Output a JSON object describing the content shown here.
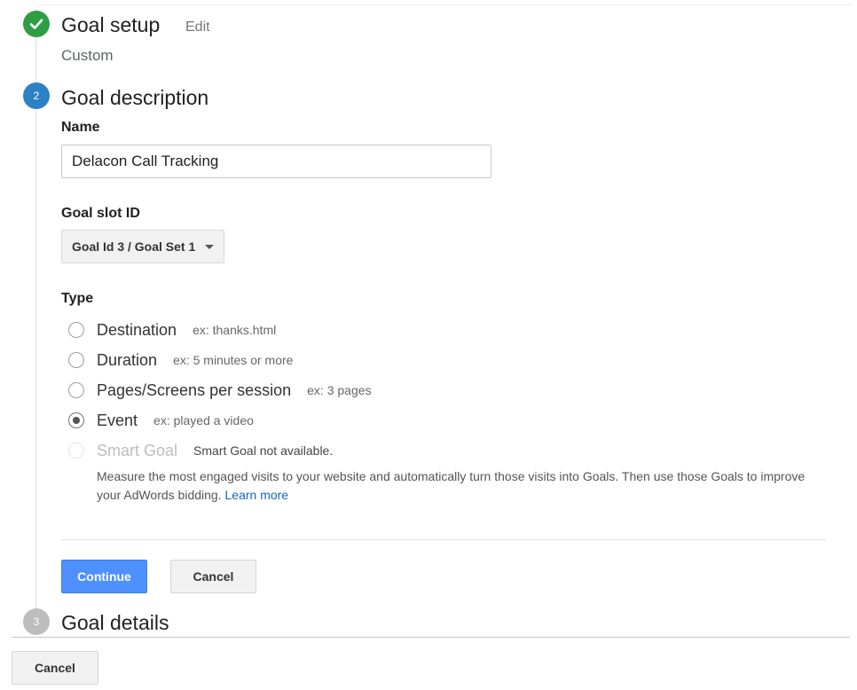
{
  "steps": {
    "setup": {
      "title": "Goal setup",
      "edit_label": "Edit",
      "value": "Custom"
    },
    "description": {
      "number": "2",
      "title": "Goal description"
    },
    "details": {
      "number": "3",
      "title": "Goal details"
    }
  },
  "form": {
    "name_label": "Name",
    "name_value": "Delacon Call Tracking",
    "slot_label": "Goal slot ID",
    "slot_value": "Goal Id 3 / Goal Set 1",
    "type_label": "Type",
    "types": [
      {
        "label": "Destination",
        "example": "ex: thanks.html",
        "selected": false
      },
      {
        "label": "Duration",
        "example": "ex: 5 minutes or more",
        "selected": false
      },
      {
        "label": "Pages/Screens per session",
        "example": "ex: 3 pages",
        "selected": false
      },
      {
        "label": "Event",
        "example": "ex: played a video",
        "selected": true
      },
      {
        "label": "Smart Goal",
        "example": "Smart Goal not available.",
        "selected": false,
        "disabled": true
      }
    ],
    "smart_goal_description": "Measure the most engaged visits to your website and automatically turn those visits into Goals. Then use those Goals to improve your AdWords bidding.",
    "learn_more": "Learn more"
  },
  "buttons": {
    "continue": "Continue",
    "cancel": "Cancel",
    "bottom_cancel": "Cancel"
  },
  "colors": {
    "check": "#2e9e44",
    "step_active": "#2d82c4",
    "step_inactive": "#bdbdbd",
    "primary": "#4d90fe",
    "link": "#1565c0"
  }
}
